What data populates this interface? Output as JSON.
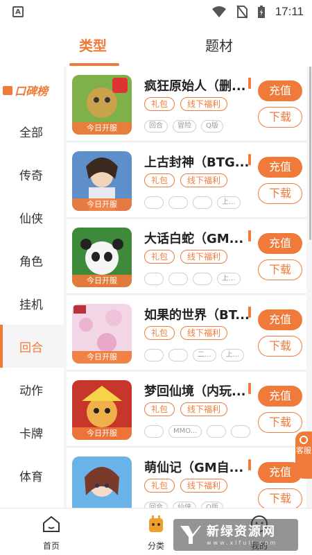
{
  "status_bar": {
    "time": "17:11"
  },
  "top_tabs": [
    {
      "label": "类型",
      "active": true
    },
    {
      "label": "题材",
      "active": false
    }
  ],
  "sidebar": {
    "header": "口碑榜",
    "items": [
      {
        "label": "全部",
        "active": false
      },
      {
        "label": "传奇",
        "active": false
      },
      {
        "label": "仙侠",
        "active": false
      },
      {
        "label": "角色",
        "active": false
      },
      {
        "label": "挂机",
        "active": false
      },
      {
        "label": "回合",
        "active": true
      },
      {
        "label": "动作",
        "active": false
      },
      {
        "label": "卡牌",
        "active": false
      },
      {
        "label": "体育",
        "active": false
      }
    ]
  },
  "games": [
    {
      "title": "疯狂原始人（删...",
      "open_label": "今日开服",
      "tags": [
        "礼包",
        "线下福利"
      ],
      "platform_tags": [
        "回合",
        "冒险",
        "Q版"
      ],
      "recharge": "充值",
      "download": "下载"
    },
    {
      "title": "上古封神（BTG...",
      "open_label": "今日开服",
      "tags": [
        "礼包",
        "线下福利"
      ],
      "platform_tags": [
        "",
        "",
        "",
        "上..."
      ],
      "recharge": "充值",
      "download": "下载"
    },
    {
      "title": "大话白蛇（GM...",
      "open_label": "今日开服",
      "tags": [
        "礼包",
        "线下福利"
      ],
      "platform_tags": [
        "",
        "",
        "",
        "上..."
      ],
      "recharge": "充值",
      "download": "下载"
    },
    {
      "title": "如果的世界（BT...",
      "open_label": "今日开服",
      "tags": [
        "礼包",
        "线下福利"
      ],
      "platform_tags": [
        "",
        "",
        "二...",
        "上..."
      ],
      "recharge": "充值",
      "download": "下载"
    },
    {
      "title": "梦回仙境（内玩...",
      "open_label": "今日开服",
      "tags": [
        "礼包",
        "线下福利"
      ],
      "platform_tags": [
        "",
        "MMO...",
        "",
        ""
      ],
      "recharge": "充值",
      "download": "下载"
    },
    {
      "title": "萌仙记（GM自...",
      "open_label": "今日开服",
      "tags": [
        "礼包",
        "线下福利"
      ],
      "platform_tags": [
        "回合",
        "仙侠",
        "Q版"
      ],
      "recharge": "充值",
      "download": "下载"
    }
  ],
  "customer_service": "客服",
  "bottom_nav": [
    {
      "label": "首页",
      "icon": "home-icon"
    },
    {
      "label": "分类",
      "icon": "category-icon"
    },
    {
      "label": "我的",
      "icon": "profile-icon"
    }
  ],
  "watermark": {
    "text": "新绿资源网",
    "sub": "www.xlfuli.com"
  },
  "colors": {
    "accent": "#f07a3a"
  }
}
